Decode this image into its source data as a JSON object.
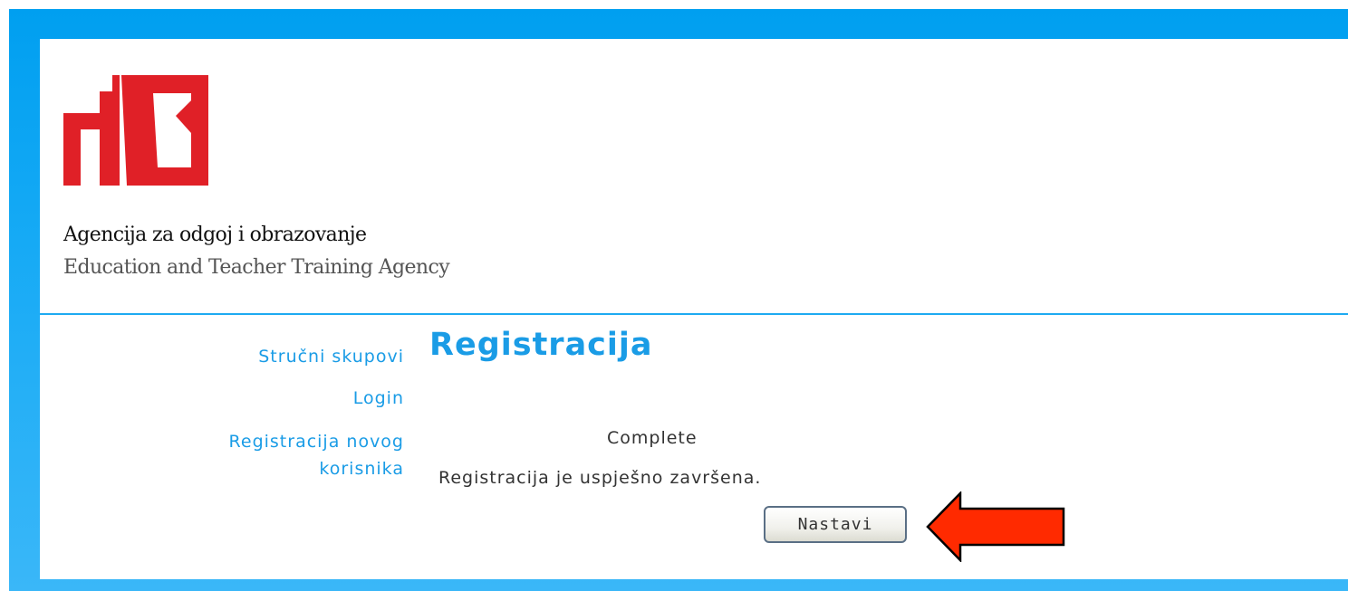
{
  "header": {
    "org_name_hr": "Agencija za odgoj i obrazovanje",
    "org_name_en": "Education and Teacher Training Agency",
    "logo_icon": "aoo-logo-icon",
    "logo_color": "#e02027"
  },
  "sidebar": {
    "items": [
      {
        "label": "Stručni skupovi"
      },
      {
        "label": "Login"
      },
      {
        "label_line1": "Registracija novog",
        "label_line2": "korisnika"
      }
    ]
  },
  "main": {
    "title": "Registracija",
    "status": "Complete",
    "message": "Registracija je uspješno završena.",
    "continue_button": "Nastavi"
  },
  "annotation": {
    "arrow_icon": "left-arrow-icon",
    "arrow_color": "#ff2a00"
  },
  "colors": {
    "frame_blue": "#009ff0",
    "link_blue": "#1a9ce6",
    "text": "#333333"
  }
}
